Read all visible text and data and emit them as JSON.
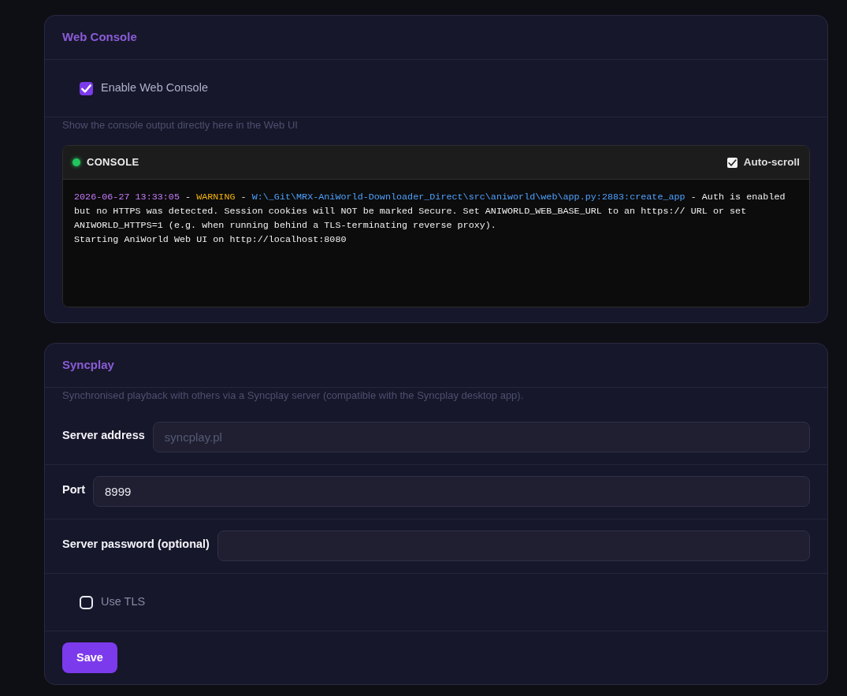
{
  "web_console": {
    "title": "Web Console",
    "enable": {
      "label": "Enable Web Console",
      "checked": true
    },
    "description": "Show the console output directly here in the Web UI",
    "console": {
      "title": "CONSOLE",
      "connected": true,
      "auto_scroll": {
        "label": "Auto-scroll",
        "checked": true
      },
      "lines": [
        {
          "segments": [
            {
              "kind": "timestamp",
              "text": "2026-06-27 13:33:05"
            },
            {
              "kind": "plain",
              "text": " - "
            },
            {
              "kind": "level",
              "text": "WARNING"
            },
            {
              "kind": "plain",
              "text": " - "
            },
            {
              "kind": "source",
              "text": "W:\\_Git\\MRX-AniWorld-Downloader_Direct\\src\\aniworld\\web\\app.py:2883:create_app"
            },
            {
              "kind": "plain",
              "text": " - Auth is enabled but no HTTPS was detected. Session cookies will NOT be marked Secure. Set ANIWORLD_WEB_BASE_URL to an https:// URL or set ANIWORLD_HTTPS=1 (e.g. when running behind a TLS-terminating reverse proxy)."
            }
          ]
        },
        {
          "segments": [
            {
              "kind": "plain",
              "text": "Starting AniWorld Web UI on http://localhost:8080"
            }
          ]
        }
      ]
    }
  },
  "syncplay": {
    "title": "Syncplay",
    "description": "Synchronised playback with others via a Syncplay server (compatible with the Syncplay desktop app).",
    "fields": [
      {
        "label": "Server address",
        "placeholder": "syncplay.pl"
      },
      {
        "label": "Port",
        "value": "8999"
      },
      {
        "label": "Server password (optional)"
      }
    ],
    "use_tls": {
      "label": "Use TLS",
      "checked": false
    },
    "save_button": "Save"
  }
}
